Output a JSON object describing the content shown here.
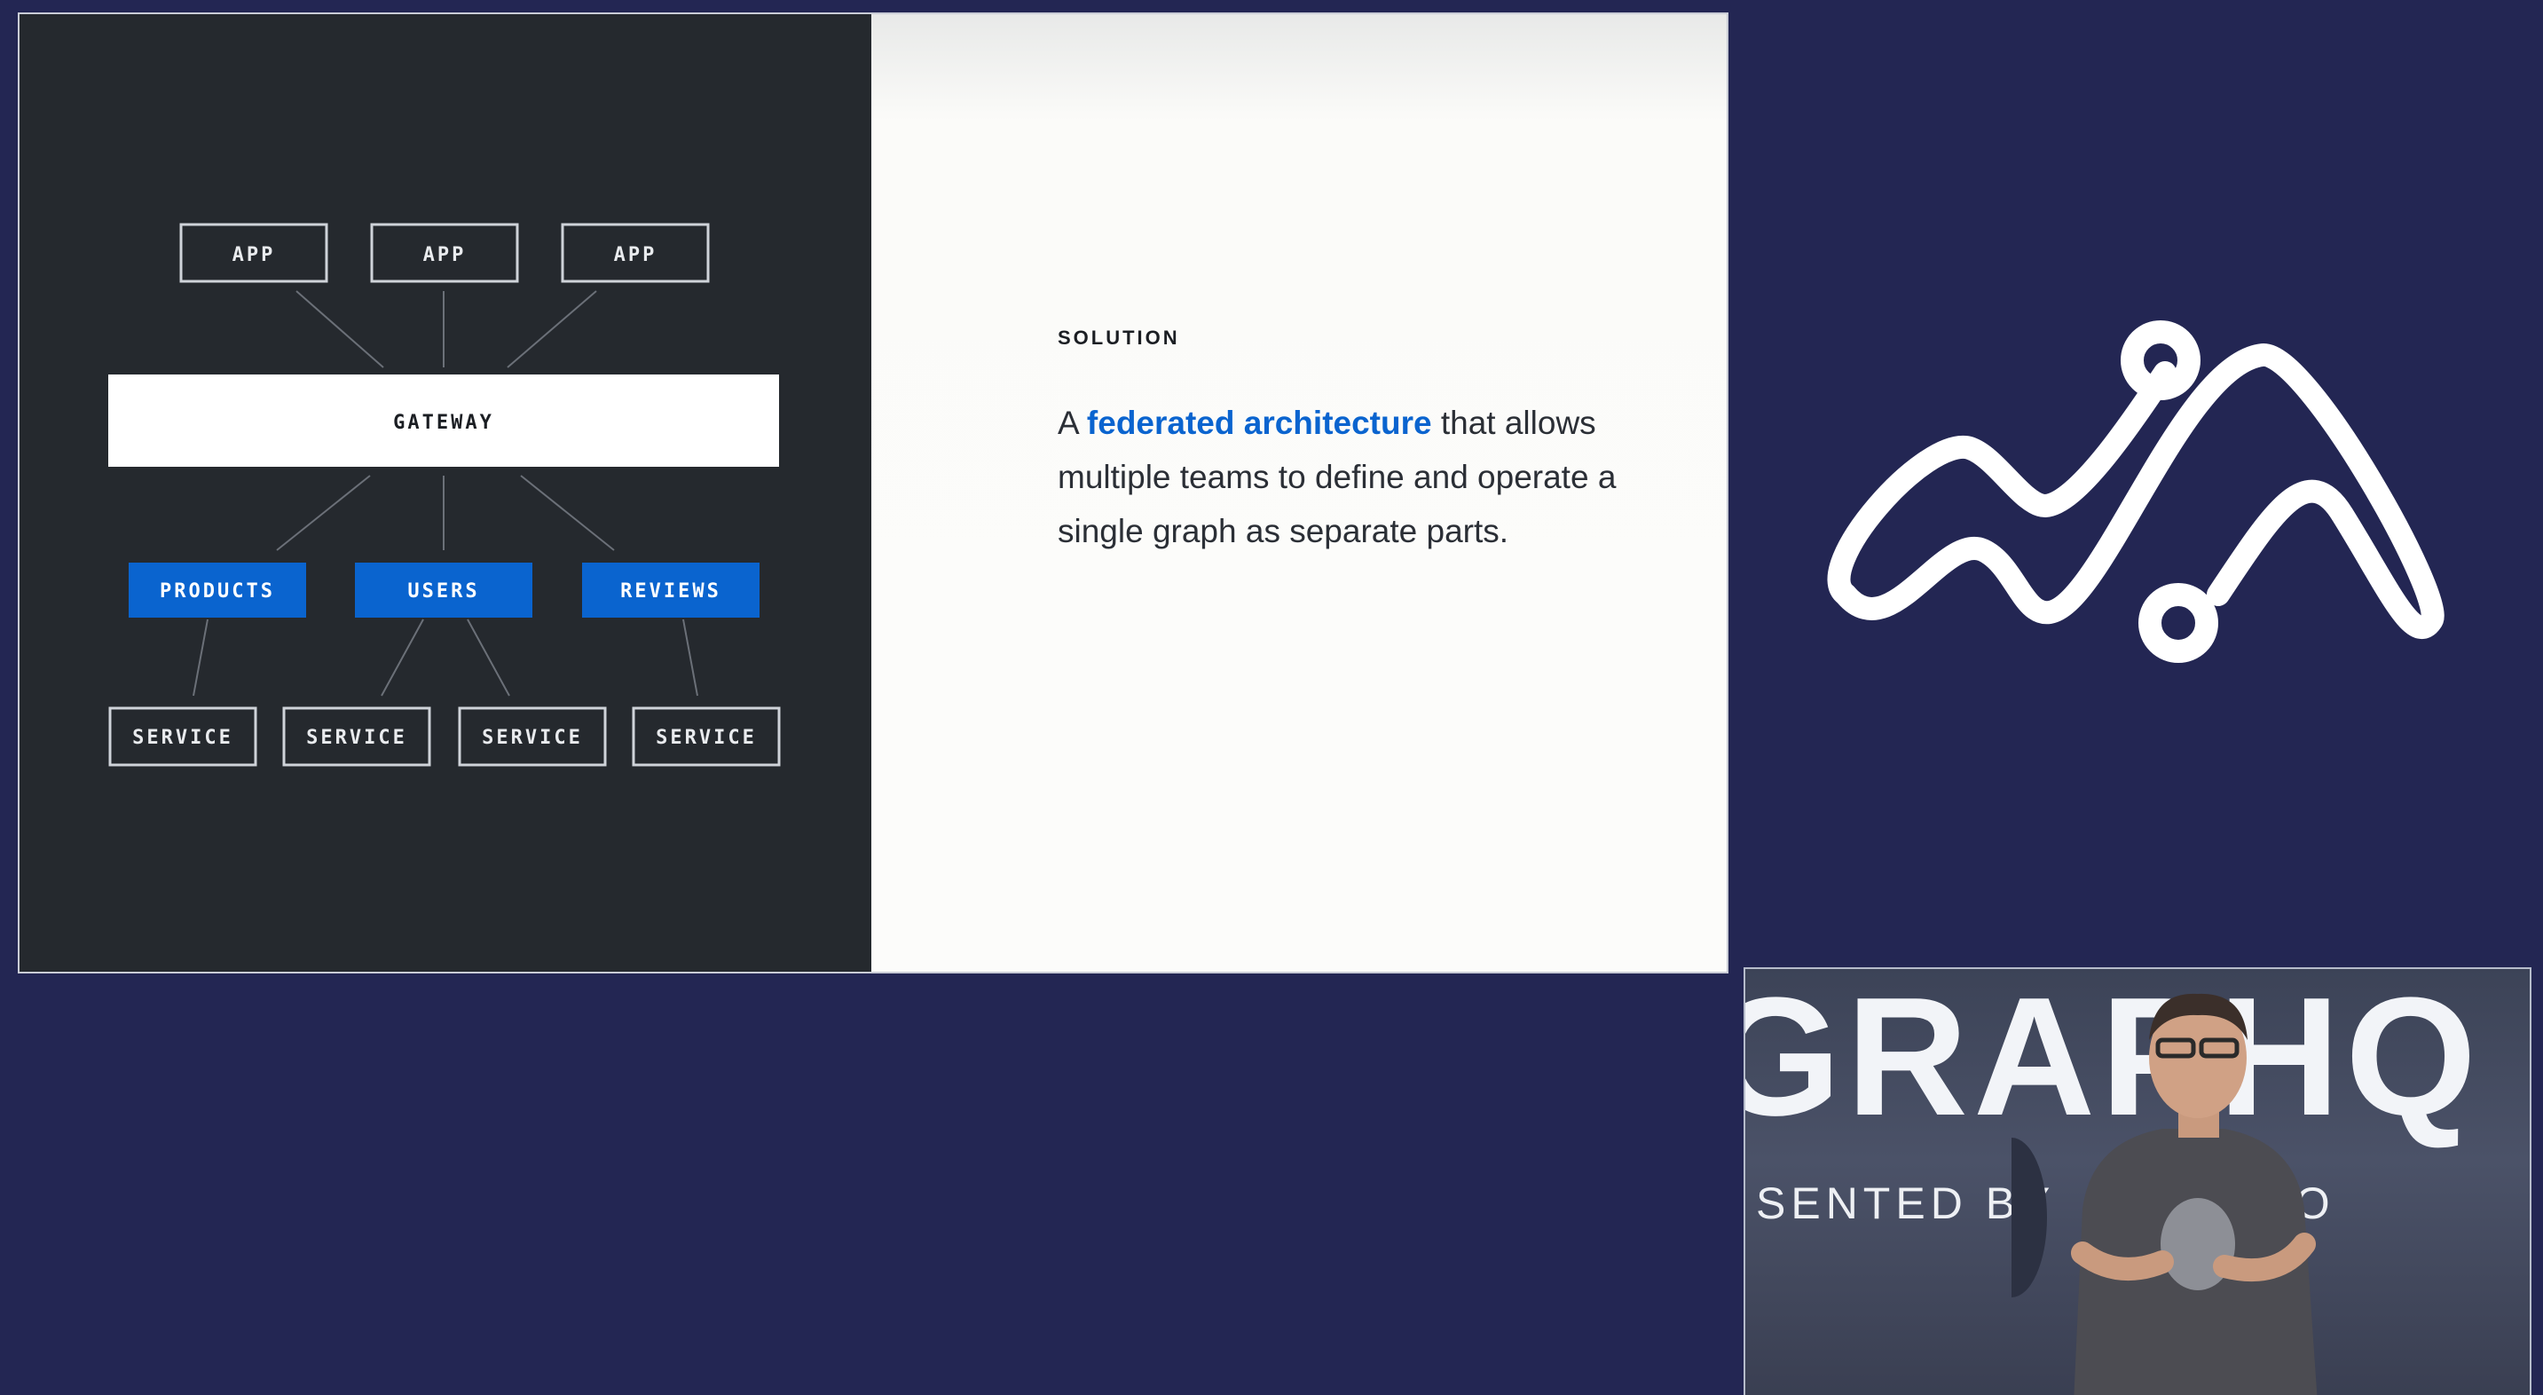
{
  "diagram": {
    "apps": [
      "APP",
      "APP",
      "APP"
    ],
    "gateway": "GATEWAY",
    "subgraphs": [
      "PRODUCTS",
      "USERS",
      "REVIEWS"
    ],
    "services": [
      "SERVICE",
      "SERVICE",
      "SERVICE",
      "SERVICE"
    ],
    "colors": {
      "panel_bg": "#25292e",
      "subgraph_blue": "#0a64cf",
      "line_gray": "#6b7078"
    }
  },
  "slide_text": {
    "label": "SOLUTION",
    "body_prefix": "A ",
    "body_highlight": "federated architecture",
    "body_suffix": " that allows multiple teams to define and operate a single graph as separate parts."
  },
  "logo": {
    "icon": "graph-logo-icon",
    "color": "#ffffff"
  },
  "camera_feed": {
    "banner_title": "GRAPHQ",
    "banner_sub_left": "SENTED BY",
    "banner_sub_right": "LO"
  },
  "colors": {
    "background": "#232653",
    "accent": "#0a64cf"
  }
}
